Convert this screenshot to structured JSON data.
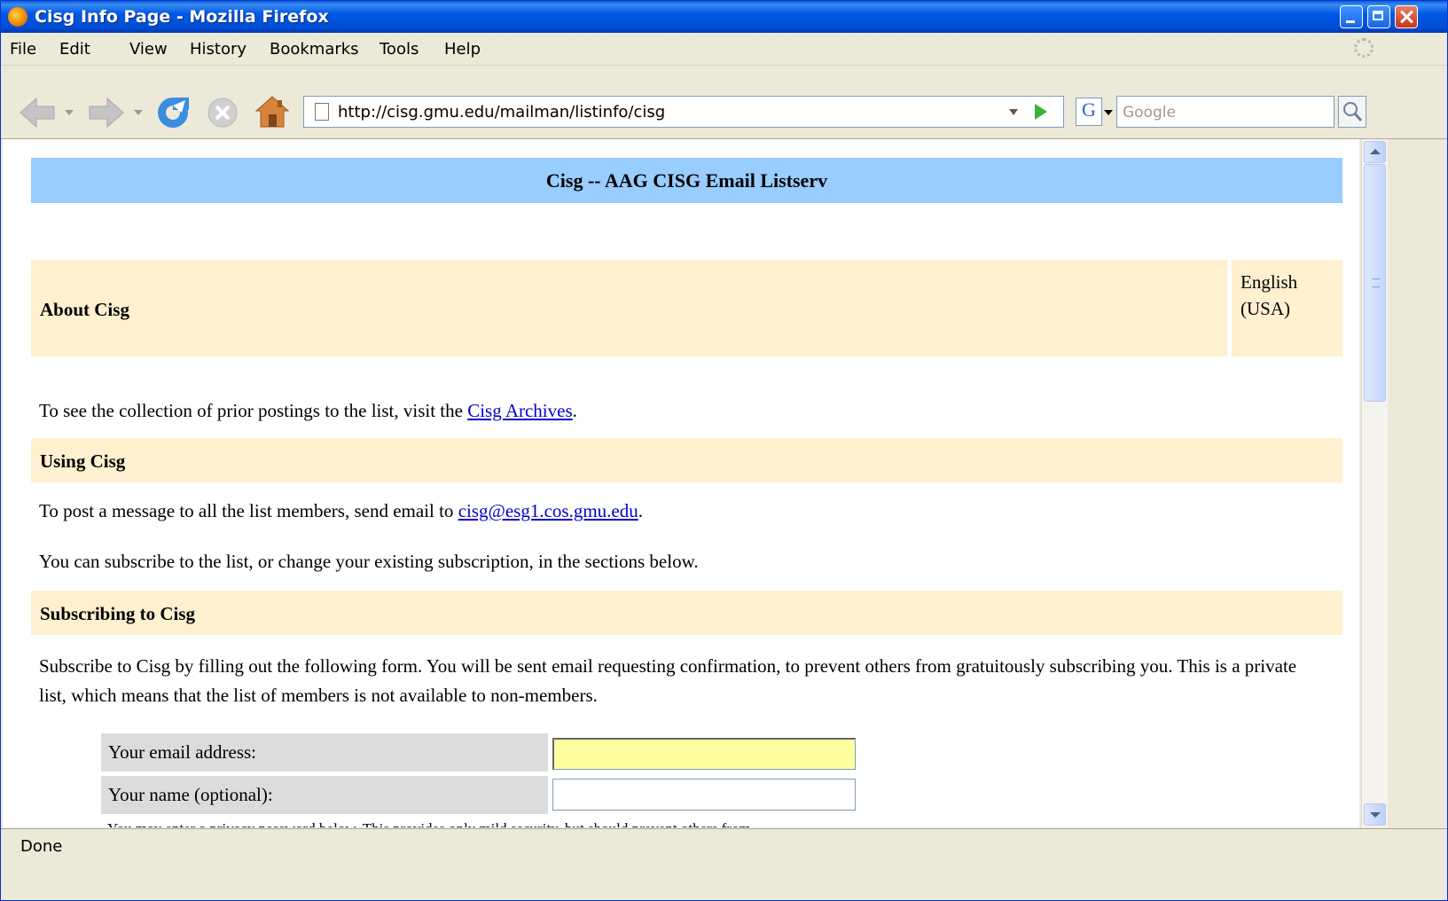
{
  "window": {
    "title": "Cisg Info Page - Mozilla Firefox"
  },
  "menu": {
    "items": [
      "File",
      "Edit",
      "View",
      "History",
      "Bookmarks",
      "Tools",
      "Help"
    ]
  },
  "toolbar": {
    "url": "http://cisg.gmu.edu/mailman/listinfo/cisg",
    "search_placeholder": "Google",
    "search_engine_glyph": "G"
  },
  "page": {
    "banner_title": "Cisg -- AAG CISG Email Listserv",
    "about_heading": "About Cisg",
    "language": "English (USA)",
    "archives_text": "To see the collection of prior postings to the list, visit the",
    "archives_link": "Cisg Archives",
    "archives_suffix": ".",
    "using_heading": "Using Cisg",
    "post_text": "To post a message to all the list members, send email to",
    "post_email": "cisg@esg1.cos.gmu.edu",
    "post_suffix": ".",
    "subscribe_intro": "You can subscribe to the list, or change your existing subscription, in the sections below.",
    "subscribing_heading": "Subscribing to Cisg",
    "subscribe_para": "Subscribe to Cisg by filling out the following form. You will be sent email requesting confirmation, to prevent others from gratuitously subscribing you. This is a private list, which means that the list of members is not available to non-members.",
    "form": {
      "email_label": "Your email address:",
      "email_value": "",
      "name_label": "Your name (optional):",
      "name_value": ""
    },
    "password_note": "You may enter a privacy password below. This provides only mild security, but should prevent others from"
  },
  "status": {
    "text": "Done"
  }
}
